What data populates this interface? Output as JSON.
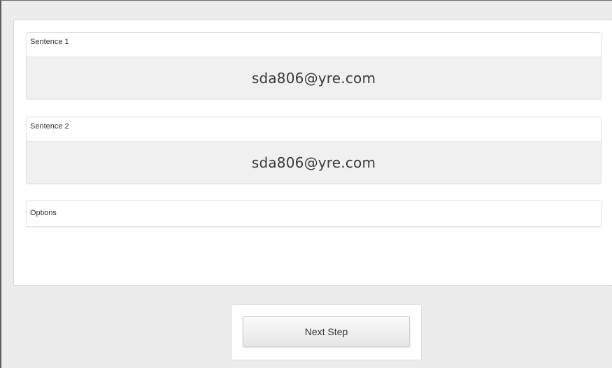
{
  "sentence1": {
    "label": "Sentence 1",
    "text": "sda806@yre.com"
  },
  "sentence2": {
    "label": "Sentence 2",
    "text": "sda806@yre.com"
  },
  "options": {
    "label": "Options"
  },
  "actions": {
    "next_label": "Next Step"
  }
}
